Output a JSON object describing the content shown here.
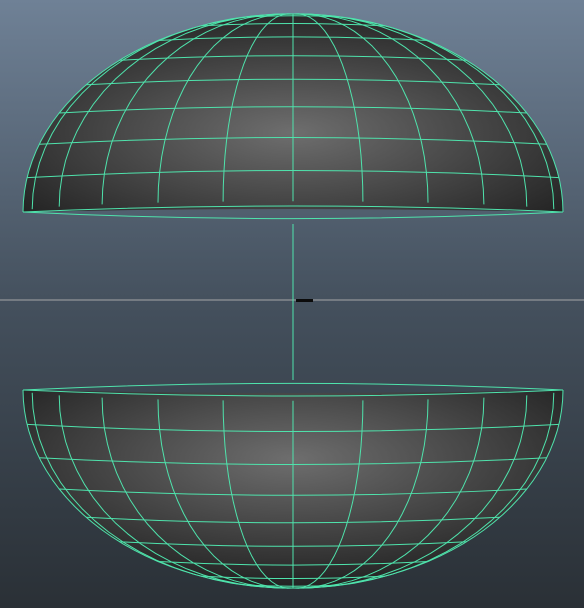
{
  "viewport": {
    "background_top": "#6f8196",
    "background_mid": "#44505d",
    "background_bottom": "#2a3036",
    "horizon_line_color": "#a6a6a6",
    "origin_marker_color": "#0b0b0b",
    "mesh_wireframe_color": "#4fe3ac",
    "mesh_shade_light": "#6e6e6e",
    "mesh_shade_dark": "#1c1c1c"
  },
  "scene": {
    "objects": [
      {
        "name": "upper-hemisphere",
        "type": "polygon-hemisphere",
        "selected": true,
        "wireframe_on_shaded": true
      },
      {
        "name": "lower-hemisphere",
        "type": "polygon-hemisphere",
        "selected": true,
        "wireframe_on_shaded": true
      }
    ],
    "view": "front-orthographic"
  }
}
